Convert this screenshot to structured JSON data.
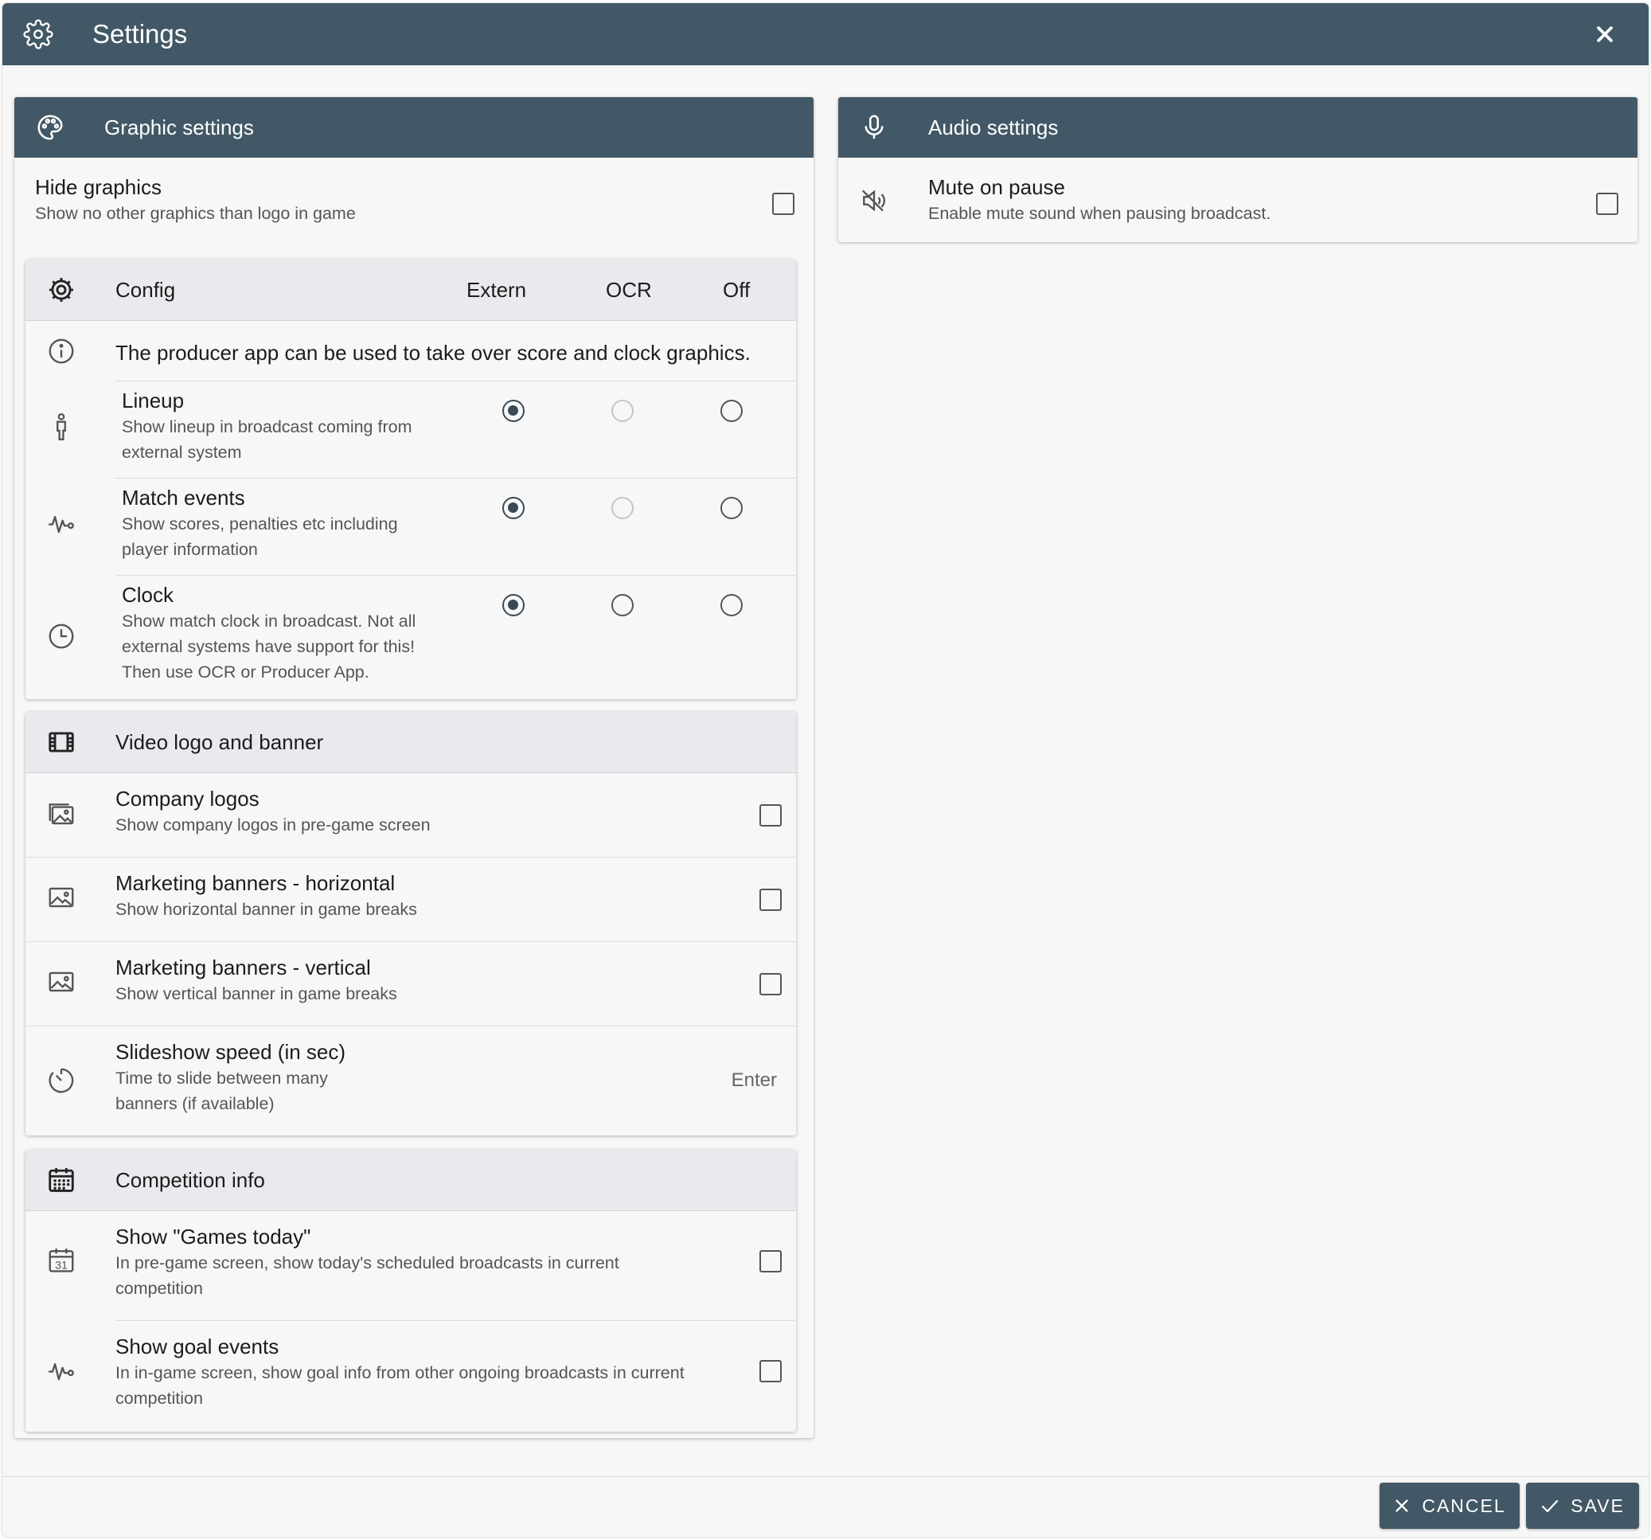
{
  "dialog": {
    "title": "Settings"
  },
  "graphic": {
    "title": "Graphic settings",
    "hide": {
      "title": "Hide graphics",
      "sub": "Show no other graphics than logo in game"
    },
    "config": {
      "title": "Config",
      "columns": [
        "Extern",
        "OCR",
        "Off"
      ],
      "info": "The producer app can be used to take over score and clock graphics.",
      "rows": [
        {
          "title": "Lineup",
          "sub1": "Show lineup in broadcast coming from",
          "sub2": "external system",
          "selected": "Extern"
        },
        {
          "title": "Match events",
          "sub1": "Show scores, penalties etc including",
          "sub2": "player information",
          "selected": "Extern"
        },
        {
          "title": "Clock",
          "sub1": "Show match clock in broadcast. Not all",
          "sub2": "external systems have support for this!",
          "sub3": "Then use OCR or Producer App.",
          "selected": "Extern"
        }
      ]
    },
    "video": {
      "title": "Video logo and banner",
      "rows": [
        {
          "title": "Company logos",
          "sub": "Show company logos in pre-game screen"
        },
        {
          "title": "Marketing banners - horizontal",
          "sub": "Show horizontal banner in game breaks"
        },
        {
          "title": "Marketing banners - vertical",
          "sub": "Show vertical banner in game breaks"
        }
      ],
      "slideshow": {
        "title": "Slideshow speed (in sec)",
        "sub1": "Time to slide between many",
        "sub2": "banners (if available)",
        "placeholder": "Enter"
      }
    },
    "competition": {
      "title": "Competition info",
      "rows": [
        {
          "title": "Show \"Games today\"",
          "sub1": "In pre-game screen, show today's scheduled broadcasts in current",
          "sub2": "competition"
        },
        {
          "title": "Show goal events",
          "sub1": "In in-game screen, show goal info from other ongoing broadcasts in current",
          "sub2": "competition"
        }
      ]
    }
  },
  "audio": {
    "title": "Audio settings",
    "mute": {
      "title": "Mute on pause",
      "sub": "Enable mute sound when pausing broadcast."
    }
  },
  "footer": {
    "cancel": "CANCEL",
    "save": "SAVE"
  }
}
